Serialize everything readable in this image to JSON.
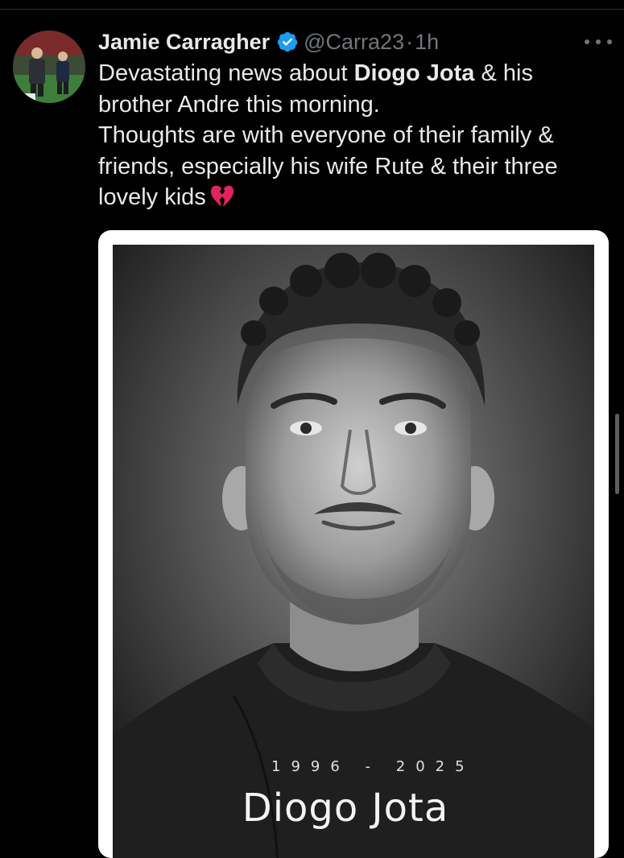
{
  "tweet": {
    "display_name": "Jamie Carragher",
    "verified": true,
    "handle": "@Carra23",
    "separator": "·",
    "time": "1h",
    "text_lines": [
      [
        "Devastating news about ",
        "Diogo Jota",
        " & his"
      ],
      [
        "brother Andre this morning."
      ],
      [
        "Thoughts are with everyone of their family &"
      ],
      [
        "friends, especially his wife Rute & their three"
      ],
      [
        "lovely kids"
      ]
    ],
    "emoji": "broken-heart-emoji"
  },
  "media": {
    "years": "1996 - 2025",
    "name": "Diogo Jota"
  },
  "colors": {
    "background": "#000000",
    "text": "#e7e9ea",
    "secondary": "#71767b",
    "verified": "#1d9bf0",
    "emoji": "#e0245e"
  }
}
